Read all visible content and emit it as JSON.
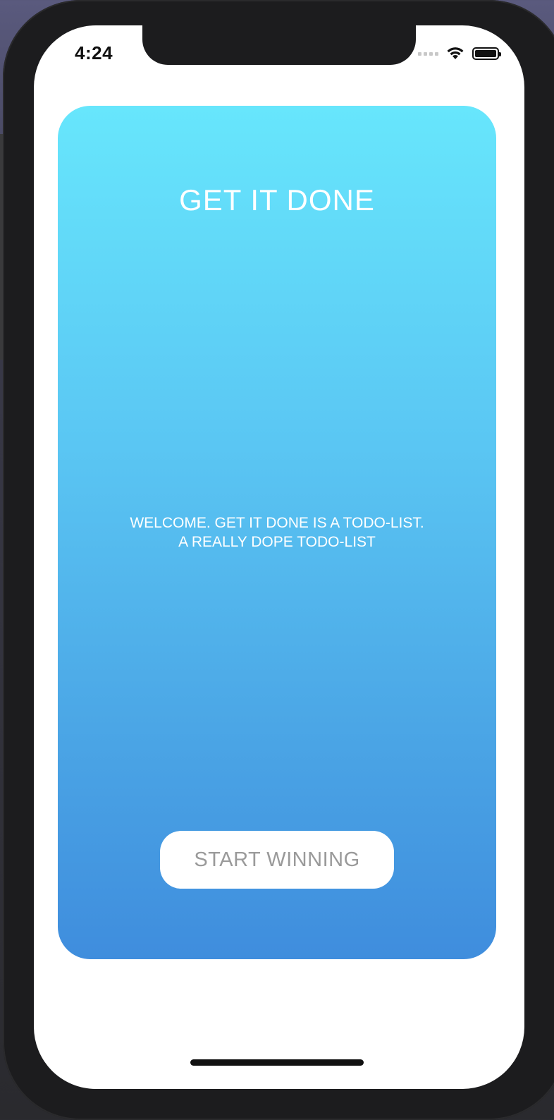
{
  "status_bar": {
    "time": "4:24",
    "signal_icon": "cellular-signal-icon",
    "wifi_icon": "wifi-icon",
    "battery_icon": "battery-icon",
    "battery_level": 1.0
  },
  "card": {
    "title": "GET IT DONE",
    "welcome_line_1": "WELCOME. GET IT DONE IS A TODO-LIST.",
    "welcome_line_2": "A REALLY DOPE TODO-LIST",
    "gradient_top": "#67e6fc",
    "gradient_bottom": "#3f8ddd"
  },
  "actions": {
    "start_label": "START WINNING"
  }
}
